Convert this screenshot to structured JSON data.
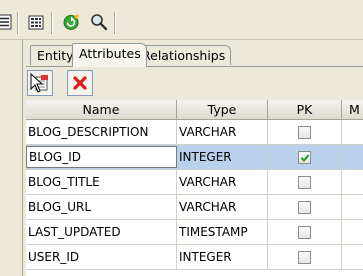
{
  "tabs": [
    {
      "label": "Entity"
    },
    {
      "label": "Attributes"
    },
    {
      "label": "Relationships"
    }
  ],
  "active_tab": "Attributes",
  "table": {
    "columns": [
      "Name",
      "Type",
      "PK",
      "M"
    ],
    "rows": [
      {
        "name": "BLOG_DESCRIPTION",
        "type": "VARCHAR",
        "pk": false
      },
      {
        "name": "BLOG_ID",
        "type": "INTEGER",
        "pk": true
      },
      {
        "name": "BLOG_TITLE",
        "type": "VARCHAR",
        "pk": false
      },
      {
        "name": "BLOG_URL",
        "type": "VARCHAR",
        "pk": false
      },
      {
        "name": "LAST_UPDATED",
        "type": "TIMESTAMP",
        "pk": false
      },
      {
        "name": "USER_ID",
        "type": "INTEGER",
        "pk": false
      }
    ],
    "selected_row": 1
  },
  "icons": {
    "toolbar": [
      "list-view-icon",
      "grid-view-icon",
      "refresh-icon",
      "search-icon"
    ],
    "sub_toolbar": [
      "add-attribute-icon",
      "delete-attribute-icon"
    ]
  },
  "colors": {
    "selection": "#b9d1ea",
    "delete_red": "#d81e1e",
    "refresh_green": "#2e9b2e"
  }
}
